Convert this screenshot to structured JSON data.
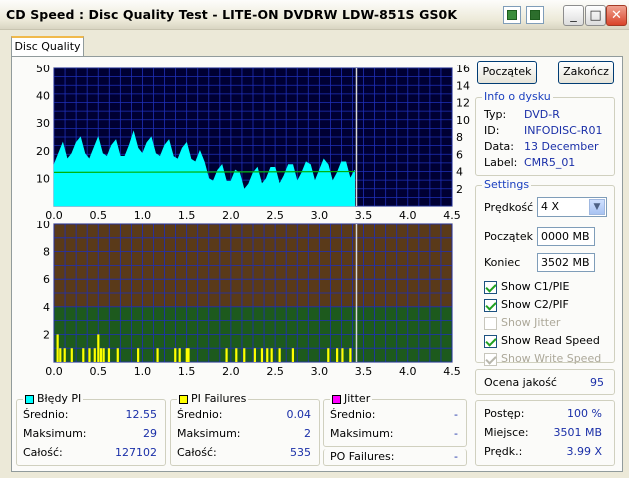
{
  "window": {
    "title": "CD Speed : Disc Quality Test - LITE-ON DVDRW LDW-851S   GS0K"
  },
  "tabs": [
    {
      "label": "Disc Quality"
    }
  ],
  "buttons": {
    "start": "Początek",
    "end": "Zakończ"
  },
  "info": {
    "title": "Info o dysku",
    "rows": [
      {
        "label": "Typ:",
        "value": "DVD-R"
      },
      {
        "label": "ID:",
        "value": "INFODISC-R01"
      },
      {
        "label": "Data:",
        "value": "13 December"
      },
      {
        "label": "Label:",
        "value": "CMR5_01"
      }
    ]
  },
  "settings": {
    "title": "Settings",
    "speed_label": "Prędkość",
    "speed_value": "4 X",
    "start_label": "Początek",
    "start_value": "0000 MB",
    "end_label": "Koniec",
    "end_value": "3502 MB",
    "checks": [
      {
        "label": "Show C1/PIE",
        "checked": true,
        "disabled": false
      },
      {
        "label": "Show C2/PIF",
        "checked": true,
        "disabled": false
      },
      {
        "label": "Show Jitter",
        "checked": false,
        "disabled": true
      },
      {
        "label": "Show Read Speed",
        "checked": true,
        "disabled": false
      },
      {
        "label": "Show Write Speed",
        "checked": true,
        "disabled": true
      }
    ]
  },
  "quality": {
    "label": "Ocena jakość",
    "value": "95"
  },
  "progress": {
    "rows": [
      {
        "label": "Postęp:",
        "value": "100 %"
      },
      {
        "label": "Miejsce:",
        "value": "3501 MB"
      },
      {
        "label": "Prędk.:",
        "value": "3.99 X"
      }
    ]
  },
  "stats": {
    "pi": {
      "title": "Błędy PI",
      "color": "#00ffff",
      "rows": [
        {
          "label": "Średnio:",
          "value": "12.55"
        },
        {
          "label": "Maksimum:",
          "value": "29"
        },
        {
          "label": "Całość:",
          "value": "127102"
        }
      ]
    },
    "pif": {
      "title": "PI Failures",
      "color": "#ffff00",
      "rows": [
        {
          "label": "Średnio:",
          "value": "0.04"
        },
        {
          "label": "Maksimum:",
          "value": "2"
        },
        {
          "label": "Całość:",
          "value": "535"
        }
      ]
    },
    "jitter": {
      "title": "Jitter",
      "color": "#ff00ff",
      "rows": [
        {
          "label": "Średnio:",
          "value": "-"
        },
        {
          "label": "Maksimum:",
          "value": "-"
        }
      ]
    },
    "po": {
      "label": "PO Failures:",
      "value": "-"
    }
  },
  "colors": {
    "chart_bg": "#000033",
    "grid": "#1e2fb8",
    "pie": "#00ffff",
    "speed": "#00b000",
    "pif": "#ffff00",
    "marker": "#d8d8d8",
    "pif_upper": "#5a3a19",
    "pif_lower": "#1d5a1d",
    "accent": "#1a3fbf"
  },
  "chart_data": [
    {
      "type": "area",
      "name": "PI errors / read speed",
      "xlim": [
        0,
        4.5
      ],
      "ylim": [
        0,
        50
      ],
      "y2lim": [
        0,
        16
      ],
      "x_ticks": [
        "0.0",
        "0.5",
        "1.0",
        "1.5",
        "2.0",
        "2.5",
        "3.0",
        "3.5",
        "4.0",
        "4.5"
      ],
      "y_ticks": [
        "10",
        "20",
        "30",
        "40",
        "50"
      ],
      "y2_ticks": [
        "2",
        "4",
        "6",
        "8",
        "10",
        "12",
        "14",
        "16"
      ],
      "series": [
        {
          "name": "PI",
          "x": [
            0.0,
            0.1,
            0.2,
            0.3,
            0.4,
            0.5,
            0.6,
            0.7,
            0.8,
            0.9,
            1.0,
            1.1,
            1.2,
            1.3,
            1.4,
            1.5,
            1.6,
            1.7,
            1.8,
            1.9,
            2.0,
            2.1,
            2.2,
            2.3,
            2.4,
            2.5,
            2.6,
            2.7,
            2.8,
            2.9,
            3.0,
            3.1,
            3.2,
            3.3,
            3.4
          ],
          "y": [
            17,
            20,
            21,
            22,
            19,
            22,
            20,
            21,
            20,
            24,
            21,
            22,
            20,
            21,
            19,
            20,
            18,
            13,
            11,
            12,
            11,
            9,
            10,
            11,
            12,
            11,
            13,
            12,
            14,
            12,
            15,
            12,
            14,
            13,
            15
          ]
        },
        {
          "name": "Read speed",
          "x": [
            0.0,
            3.4
          ],
          "y": [
            3.9,
            3.99
          ]
        }
      ],
      "marker_x": 3.42
    },
    {
      "type": "bar",
      "name": "PI failures",
      "xlim": [
        0,
        4.5
      ],
      "ylim": [
        0,
        10
      ],
      "x_ticks": [
        "0.0",
        "0.5",
        "1.0",
        "1.5",
        "2.0",
        "2.5",
        "3.0",
        "3.5",
        "4.0",
        "4.5"
      ],
      "y_ticks": [
        "2",
        "4",
        "6",
        "8",
        "10"
      ],
      "x": [
        0.04,
        0.07,
        0.12,
        0.2,
        0.33,
        0.4,
        0.46,
        0.5,
        0.53,
        0.56,
        0.62,
        0.72,
        0.95,
        1.17,
        1.37,
        1.42,
        1.5,
        1.52,
        1.95,
        2.06,
        2.15,
        2.27,
        2.35,
        2.41,
        2.46,
        2.55,
        2.7,
        3.1,
        3.2,
        3.26,
        3.35
      ],
      "y": [
        2,
        1,
        1,
        1,
        1,
        1,
        1,
        2,
        1,
        1,
        1,
        1,
        1,
        1,
        1,
        1,
        1,
        1,
        1,
        1,
        1,
        1,
        1,
        1,
        1,
        1,
        1,
        1,
        1,
        1,
        1
      ],
      "marker_x": 3.42
    }
  ]
}
